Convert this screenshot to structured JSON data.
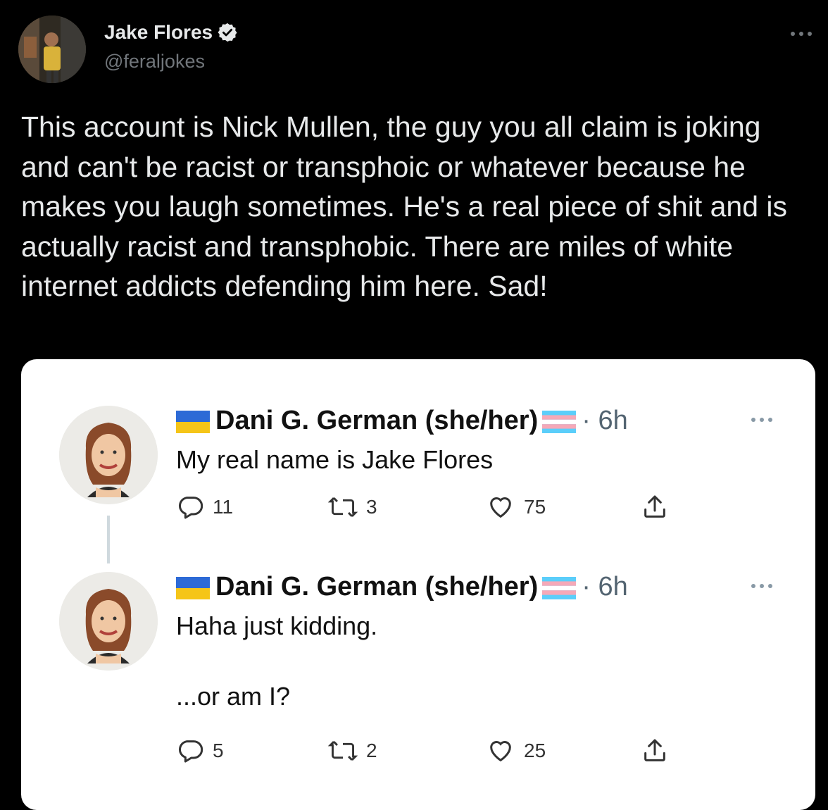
{
  "author": {
    "name": "Jake Flores",
    "handle": "@feraljokes",
    "verified": true
  },
  "tweet": {
    "text": "This account is Nick Mullen, the guy you all claim is joking and can't be racist or transphoic or whatever because he makes you laugh sometimes. He's a real piece of shit and is actually racist and transphobic. There are miles of white internet addicts defending him here. Sad!"
  },
  "quoted": [
    {
      "name": "Dani G. German (she/her)",
      "time": "· 6h",
      "text": "My real name is Jake Flores",
      "replies": "11",
      "retweets": "3",
      "likes": "75"
    },
    {
      "name": "Dani G. German (she/her)",
      "time": "· 6h",
      "text": "Haha just kidding.\n\n...or am I?",
      "replies": "5",
      "retweets": "2",
      "likes": "25"
    }
  ],
  "icons": {
    "more": "more-horizontal-icon",
    "verified": "verified-badge-icon",
    "reply": "reply-icon",
    "retweet": "retweet-icon",
    "like": "heart-icon",
    "share": "share-icon",
    "flag_left": "ukraine-flag-icon",
    "flag_right": "transgender-flag-icon"
  },
  "colors": {
    "background": "#000000",
    "text": "#e7e9ea",
    "muted": "#71767b",
    "card": "#ffffff"
  }
}
